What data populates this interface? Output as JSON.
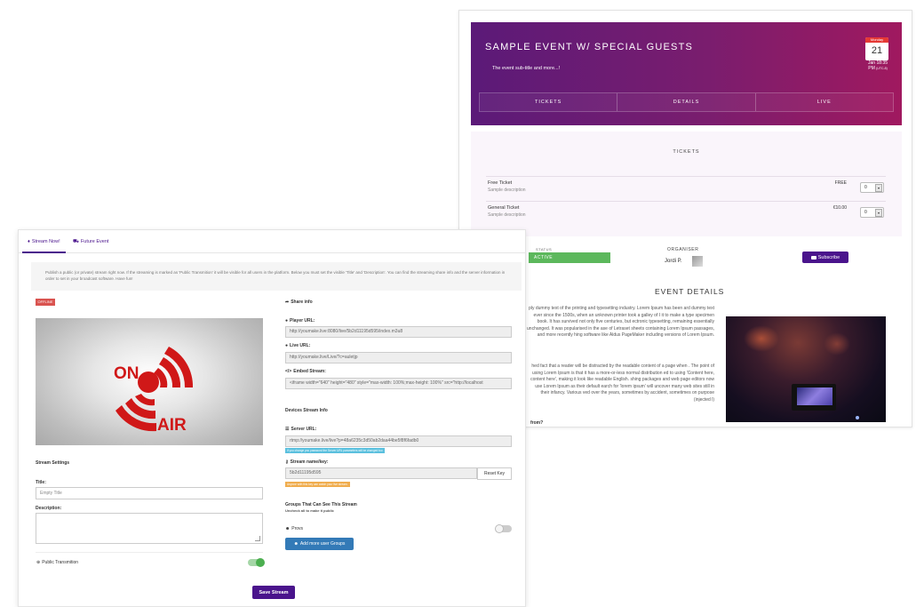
{
  "event_page": {
    "title": "SAMPLE EVENT W/ SPECIAL GUESTS",
    "subtitle": "The event sub-title and more...!",
    "calendar": {
      "month": "Monday",
      "day": "21",
      "date": "Jan 18:35",
      "time": "PM",
      "tz": "(UTC-8)"
    },
    "tabs": [
      "TICKETS",
      "DETAILS",
      "LIVE"
    ],
    "tickets_heading": "TICKETS",
    "tickets": [
      {
        "name": "Free Ticket",
        "description": "Sample description",
        "price": "FREE",
        "qty": "0"
      },
      {
        "name": "General Ticket",
        "description": "Sample description",
        "price": "€10.00",
        "qty": "0"
      }
    ],
    "status_label": "STATUS",
    "status_value": "ACTIVE",
    "organiser_label": "ORGANISER",
    "organiser_name": "Jordi P.",
    "subscribe_label": "Subscribe",
    "details_heading": "EVENT DETAILS",
    "details_p1": "ply dummy text of the printing and typesetting industry. Lorem Ipsum has been ard dummy text ever since the 1500s, when an unknown printer took a galley of I it to make a type specimen book. It has survived not only five centuries, but ectronic typesetting, remaining essentially unchanged. It was popularised in the ase of Letraset sheets containing Lorem Ipsum passages, and more recently hing software like Aldus PageMaker including versions of Lorem Ipsum.",
    "details_p2": "hed fact that a reader will be distracted by the readable content of a page when . The point of using Lorem Ipsum is that it has a more-or-less normal distribution ed to using 'Content here, content here', making it look like readable English. shing packages and web page editors now use Lorem Ipsum as their default earch for 'lorem ipsum' will uncover many web sites still in their infancy. Various ved over the years, sometimes by accident, sometimes on purpose (injected l)",
    "details_q": "from?"
  },
  "stream_page": {
    "tabs": {
      "stream_now": "Stream Now!",
      "future_event": "Future Event"
    },
    "intro": "Publish a public (or private) stream right now. If the streaming is marked as 'Public Transmition' it will be visible for all users in the platform. Below you must set the visible 'Title' and 'Description'. You can find the streaming share info and the server information in order to set in your broadcast software. Have fun!",
    "offline_badge": "OFFLINE",
    "on_air_text": {
      "on": "ON",
      "air": "AIR"
    },
    "settings_title": "Stream Settings",
    "title_label": "Title:",
    "title_value": "Empty Title",
    "description_label": "Description:",
    "public_label": "Public Transmition",
    "public_on": true,
    "save_label": "Save Stream",
    "share_title": "Share info",
    "player_label": "Player URL:",
    "player_url": "http://youmake.live:8080/live/5b2d11195d595/index.m3u8",
    "live_label": "Live URL:",
    "live_url": "http://youmake.live/Live/?c=auletjp",
    "embed_label": "Embed Stream:",
    "embed_code": "<iframe width=\"640\" height=\"480\" style=\"max-width: 100%;max-height: 100%\" src=\"http://localhost",
    "devices_title": "Devices Stream Info",
    "server_label": "Server URL:",
    "server_url": "rtmp://youmake.live/live?p=48a6235c3d50ab2daa44be5f8f6fadb0",
    "server_note": "If you change you password the Server URL parameters will be changed too",
    "key_label": "Stream name/key:",
    "stream_key": "5b2d11195d595",
    "reset_key": "Reset Key",
    "key_note": "Anyone with this key can watch your live stream.",
    "groups_title": "Groups That Can See This Stream",
    "groups_sub": "Uncheck all to make it public",
    "group_name": "Provs",
    "add_groups": "Add more user Groups"
  },
  "colors": {
    "accent": "#4a148c",
    "status": "#5cb85c",
    "offline": "#d9534f",
    "info": "#5bc0de",
    "warn": "#f0ad4e",
    "primary": "#337ab7"
  }
}
